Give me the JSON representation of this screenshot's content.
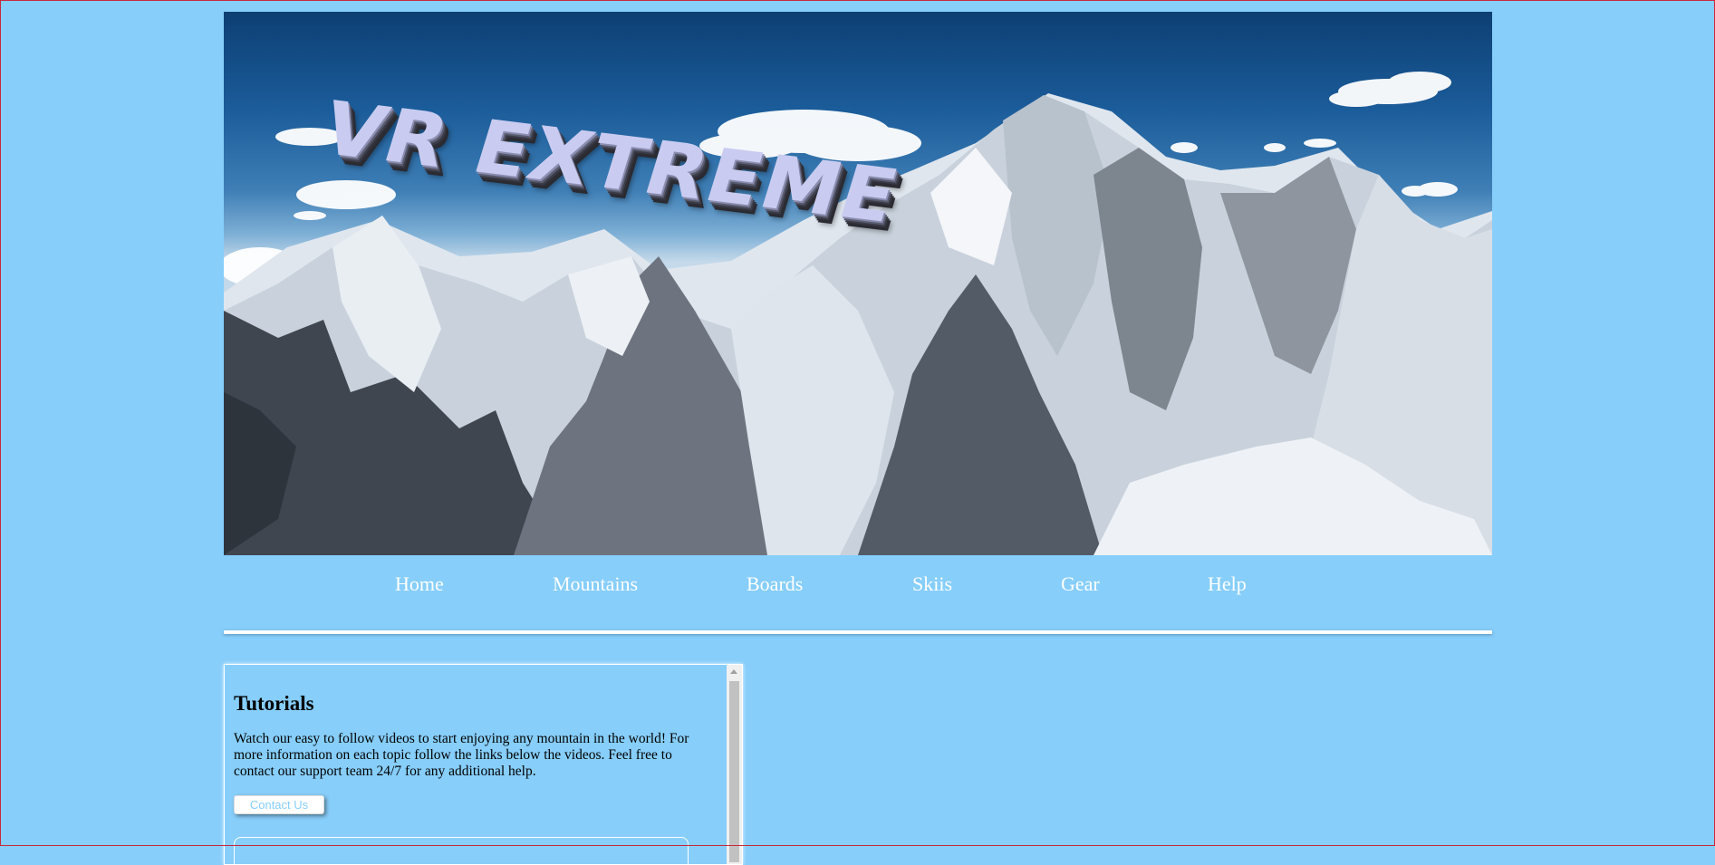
{
  "header": {
    "logo_text": "VR EXTREME"
  },
  "nav": {
    "items": [
      {
        "label": "Home"
      },
      {
        "label": "Mountains"
      },
      {
        "label": "Boards"
      },
      {
        "label": "Skiis"
      },
      {
        "label": "Gear"
      },
      {
        "label": "Help"
      }
    ]
  },
  "tutorials": {
    "title": "Tutorials",
    "body": "Watch our easy to follow videos to start enjoying any mountain in the world! For more information on each topic follow the links below the videos. Feel free to contact our support team 24/7 for any additional help.",
    "contact_button": "Contact Us"
  },
  "colors": {
    "page_background": "#87cefa",
    "nav_text": "#ffffff",
    "button_text": "#87cefa"
  }
}
